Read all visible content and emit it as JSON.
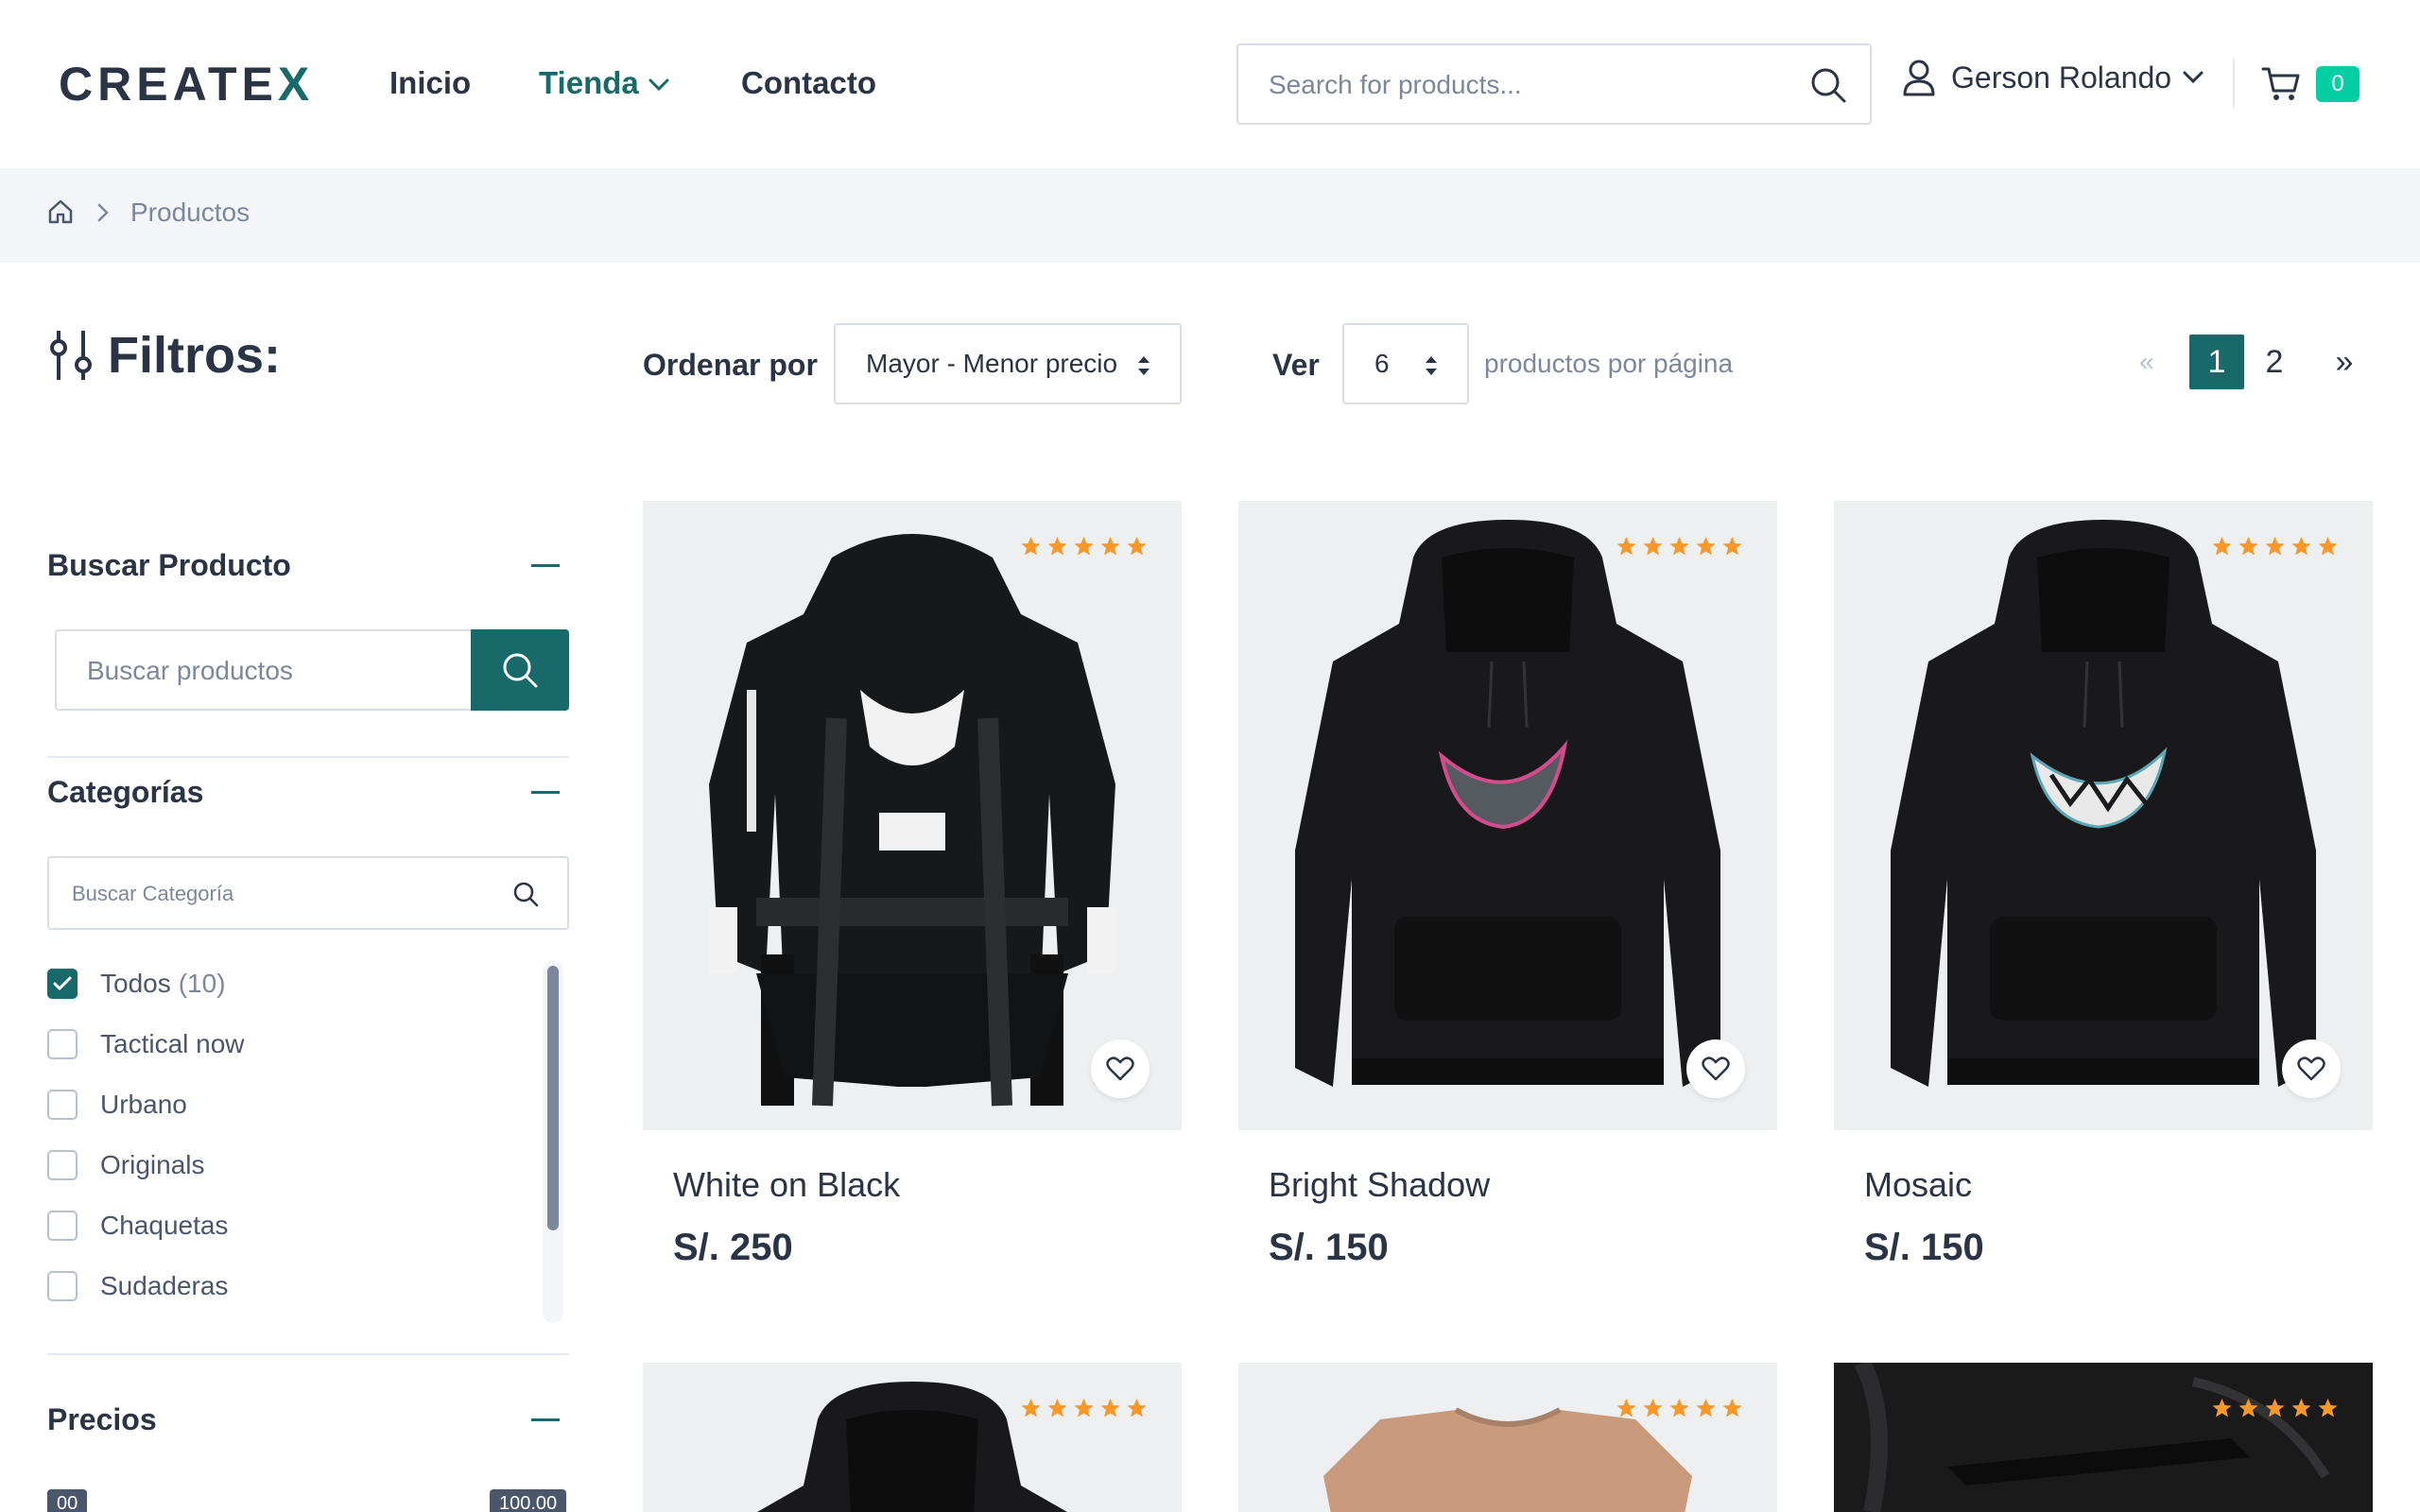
{
  "header": {
    "logo": "CREATEX",
    "nav": [
      {
        "label": "Inicio"
      },
      {
        "label": "Tienda"
      },
      {
        "label": "Contacto"
      }
    ],
    "search_placeholder": "Search for products...",
    "user_name": "Gerson Rolando",
    "cart_count": "0"
  },
  "breadcrumb": {
    "current": "Productos"
  },
  "sidebar": {
    "title": "Filtros:",
    "search_section": {
      "title": "Buscar Producto",
      "placeholder": "Buscar productos"
    },
    "categories_section": {
      "title": "Categorías",
      "search_placeholder": "Buscar Categoría",
      "items": [
        {
          "label": "Todos",
          "count": "(10)",
          "checked": true
        },
        {
          "label": "Tactical now",
          "count": "",
          "checked": false
        },
        {
          "label": "Urbano",
          "count": "",
          "checked": false
        },
        {
          "label": "Originals",
          "count": "",
          "checked": false
        },
        {
          "label": "Chaquetas",
          "count": "",
          "checked": false
        },
        {
          "label": "Sudaderas",
          "count": "",
          "checked": false
        }
      ]
    },
    "prices_section": {
      "title": "Precios",
      "min_label": "00",
      "max_label": "100.00"
    }
  },
  "toolbar": {
    "sort_label": "Ordenar por",
    "sort_value": "Mayor - Menor precio",
    "view_label": "Ver",
    "view_value": "6",
    "per_page_text": "productos por página",
    "pagination": {
      "prev": "«",
      "pages": [
        "1",
        "2"
      ],
      "current": "1",
      "next": "»"
    }
  },
  "products": [
    {
      "name": "White on Black",
      "price": "S/. 250",
      "rating": 5
    },
    {
      "name": "Bright Shadow",
      "price": "S/. 150",
      "rating": 5
    },
    {
      "name": "Mosaic",
      "price": "S/. 150",
      "rating": 5
    }
  ],
  "colors": {
    "accent": "#17696a",
    "badge": "#03cea4",
    "star": "#f89828",
    "text": "#2b3445",
    "muted": "#7d879c",
    "image_bg": "#eeeff1"
  }
}
